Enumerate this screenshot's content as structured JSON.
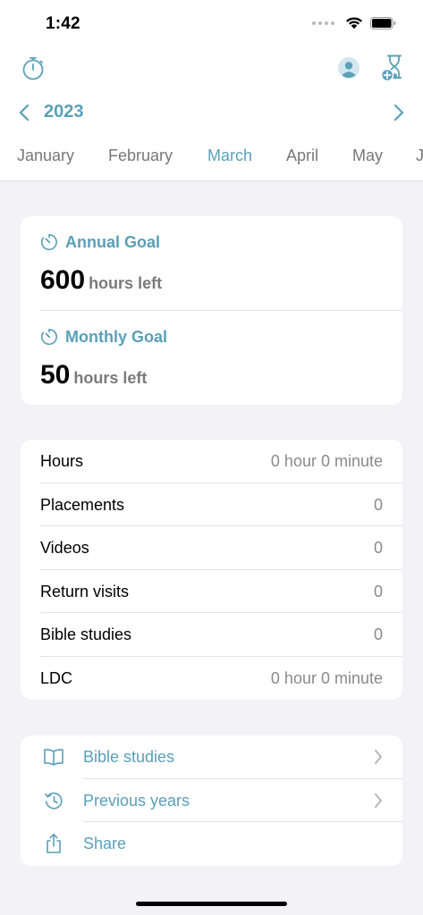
{
  "status_bar": {
    "time": "1:42",
    "icons": [
      "cellular-dots-icon",
      "wifi-icon",
      "battery-icon"
    ]
  },
  "toolbar": {
    "left_icon": "stopwatch-icon",
    "right_icons": [
      "profile-icon",
      "hourglass-add-icon"
    ]
  },
  "year_nav": {
    "year": "2023",
    "prev_icon": "chevron-left-icon",
    "next_icon": "chevron-right-icon"
  },
  "months": {
    "items": [
      "January",
      "February",
      "March",
      "April",
      "May",
      "J"
    ],
    "selected": "March"
  },
  "goals": {
    "annual": {
      "title": "Annual Goal",
      "value": "600",
      "unit": "hours left"
    },
    "monthly": {
      "title": "Monthly Goal",
      "value": "50",
      "unit": "hours left"
    }
  },
  "stats": [
    {
      "label": "Hours",
      "value": "0 hour 0 minute"
    },
    {
      "label": "Placements",
      "value": "0"
    },
    {
      "label": "Videos",
      "value": "0"
    },
    {
      "label": "Return visits",
      "value": "0"
    },
    {
      "label": "Bible studies",
      "value": "0"
    },
    {
      "label": "LDC",
      "value": "0 hour 0 minute"
    }
  ],
  "links": [
    {
      "label": "Bible studies",
      "icon": "book-icon",
      "has_chevron": true
    },
    {
      "label": "Previous years",
      "icon": "history-icon",
      "has_chevron": true
    },
    {
      "label": "Share",
      "icon": "share-icon",
      "has_chevron": false
    }
  ],
  "colors": {
    "accent": "#5b9fb8",
    "background": "#f2f2f7",
    "card": "#ffffff",
    "secondary_text": "#8a8a8a"
  }
}
